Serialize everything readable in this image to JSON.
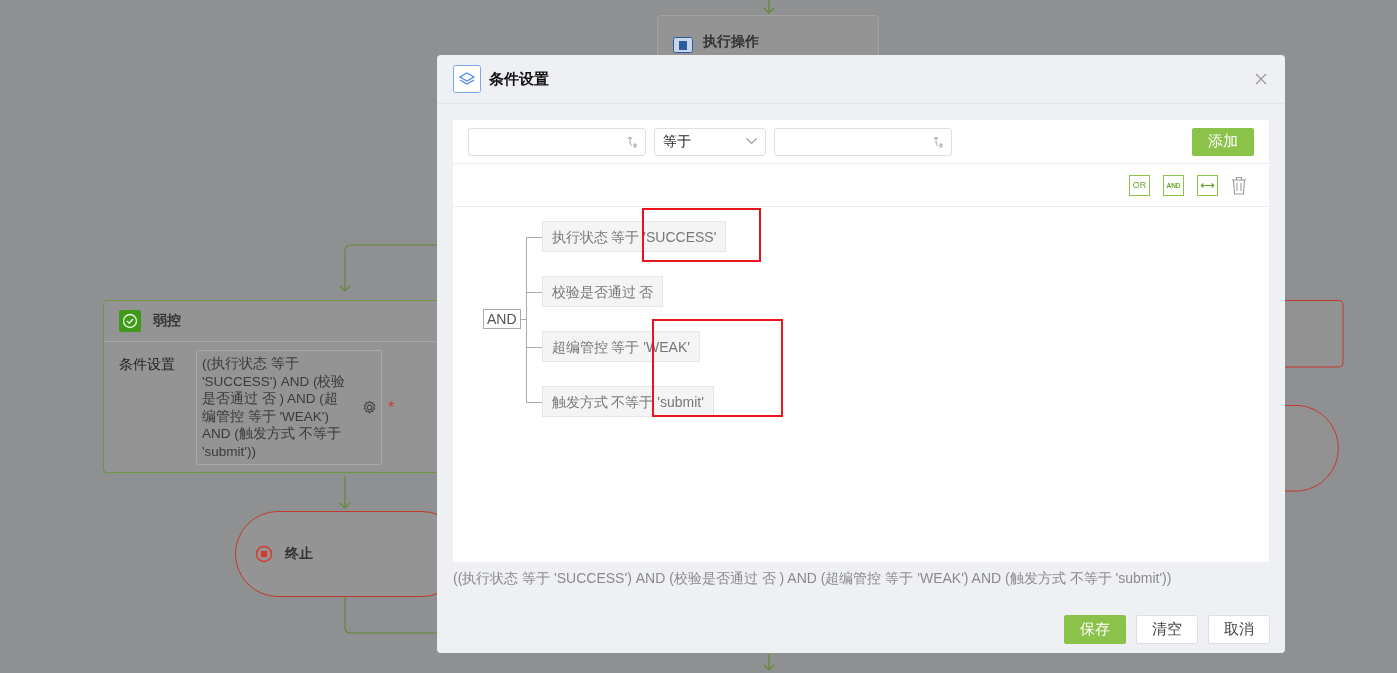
{
  "canvas": {
    "nodes": [
      {
        "kind": "action",
        "title": "执行操作"
      },
      {
        "kind": "condition",
        "title": "弱控",
        "field_label": "条件设置",
        "field_value": "((执行状态 等于 'SUCCESS') AND (校验是否通过 否 ) AND (超编管控 等于 'WEAK') AND (触发方式 不等于 'submit'))",
        "required_mark": "*"
      },
      {
        "kind": "end",
        "title": "终止"
      }
    ]
  },
  "dialog": {
    "title": "条件设置",
    "operator_select": {
      "value": "等于"
    },
    "add_button": "添加",
    "toolbar": [
      {
        "kind": "or",
        "label": "OR"
      },
      {
        "kind": "and",
        "label": "AND"
      },
      {
        "kind": "swap"
      },
      {
        "kind": "delete"
      }
    ],
    "tree": {
      "operator": "AND",
      "conditions": [
        "执行状态 等于 'SUCCESS'",
        "校验是否通过 否",
        "超编管控 等于 'WEAK'",
        "触发方式 不等于 'submit'"
      ]
    },
    "expression": "((执行状态 等于 'SUCCESS') AND (校验是否通过 否 ) AND (超编管控 等于 'WEAK') AND (触发方式 不等于 'submit'))",
    "buttons": [
      {
        "kind": "primary",
        "label": "保存"
      },
      {
        "kind": "default",
        "label": "清空"
      },
      {
        "kind": "default",
        "label": "取消"
      }
    ]
  }
}
